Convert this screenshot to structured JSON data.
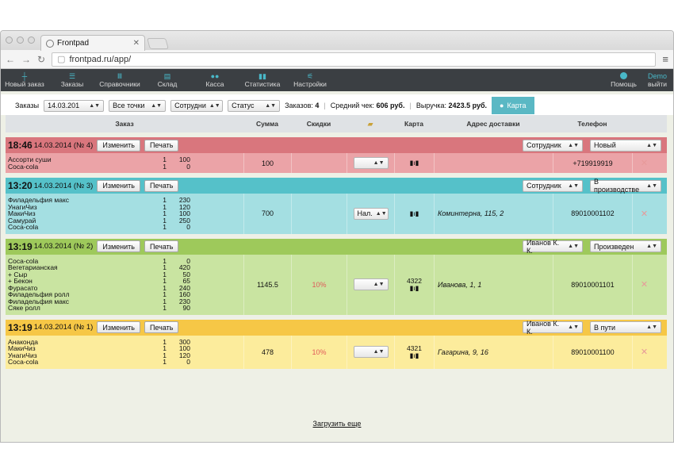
{
  "browser": {
    "tab_title": "Frontpad",
    "url": "frontpad.ru/app/"
  },
  "nav": {
    "items": [
      {
        "label": "Новый заказ",
        "icon": "plus-icon"
      },
      {
        "label": "Заказы",
        "icon": "list-icon"
      },
      {
        "label": "Справочники",
        "icon": "book-icon"
      },
      {
        "label": "Склад",
        "icon": "box-icon"
      },
      {
        "label": "Касса",
        "icon": "cash-icon"
      },
      {
        "label": "Статистика",
        "icon": "chart-icon"
      },
      {
        "label": "Настройки",
        "icon": "settings-icon"
      }
    ],
    "help": "Помощь",
    "user": "Demo",
    "logout": "выйти"
  },
  "filters": {
    "orders_label": "Заказы",
    "date": "14.03.201",
    "points": "Все точки",
    "staff": "Сотрудни",
    "status": "Статус",
    "count_label": "Заказов:",
    "count": "4",
    "avg_label": "Средний чек:",
    "avg": "606 руб.",
    "revenue_label": "Выручка:",
    "revenue": "2423.5 руб.",
    "map": "Карта"
  },
  "columns": {
    "order": "Заказ",
    "sum": "Сумма",
    "discount": "Скидки",
    "card": "Карта",
    "address": "Адрес доставки",
    "phone": "Телефон"
  },
  "orders": [
    {
      "time": "18:46",
      "date": "14.03.2014 (№ 4)",
      "edit": "Изменить",
      "print": "Печать",
      "staff": "Сотрудник",
      "status": "Новый",
      "items": [
        {
          "name": "Ассорти суши",
          "qty": "1",
          "price": "100"
        },
        {
          "name": "Coca-cola",
          "qty": "1",
          "price": "0"
        }
      ],
      "sum": "100",
      "discount": "",
      "payment": "",
      "card": "",
      "address": "",
      "phone": "+719919919"
    },
    {
      "time": "13:20",
      "date": "14.03.2014 (№ 3)",
      "edit": "Изменить",
      "print": "Печать",
      "staff": "Сотрудник",
      "status": "В производстве",
      "items": [
        {
          "name": "Филадельфия макс",
          "qty": "1",
          "price": "230"
        },
        {
          "name": "УнагиЧиз",
          "qty": "1",
          "price": "120"
        },
        {
          "name": "МакиЧиз",
          "qty": "1",
          "price": "100"
        },
        {
          "name": "Самурай",
          "qty": "1",
          "price": "250"
        },
        {
          "name": "Coca-cola",
          "qty": "1",
          "price": "0"
        }
      ],
      "sum": "700",
      "discount": "",
      "payment": "Нал.",
      "card": "",
      "address": "Коминтерна, 115, 2",
      "phone": "89010001102"
    },
    {
      "time": "13:19",
      "date": "14.03.2014 (№ 2)",
      "edit": "Изменить",
      "print": "Печать",
      "staff": "Иванов К. К.",
      "status": "Произведен",
      "items": [
        {
          "name": "Coca-cola",
          "qty": "1",
          "price": "0"
        },
        {
          "name": "Вегетарианская",
          "qty": "1",
          "price": "420"
        },
        {
          "name": "+ Сыр",
          "qty": "1",
          "price": "50"
        },
        {
          "name": "+ Бекон",
          "qty": "1",
          "price": "65"
        },
        {
          "name": "Фурасато",
          "qty": "1",
          "price": "240"
        },
        {
          "name": "Филадельфия ролл",
          "qty": "1",
          "price": "160"
        },
        {
          "name": "Филадельфия макс",
          "qty": "1",
          "price": "230"
        },
        {
          "name": "Сяке ролл",
          "qty": "1",
          "price": "90"
        }
      ],
      "sum": "1145.5",
      "discount": "10%",
      "payment": "",
      "card": "4322",
      "address": "Иванова, 1, 1",
      "phone": "89010001101"
    },
    {
      "time": "13:19",
      "date": "14.03.2014 (№ 1)",
      "edit": "Изменить",
      "print": "Печать",
      "staff": "Иванов К. К.",
      "status": "В пути",
      "items": [
        {
          "name": "Анаконда",
          "qty": "1",
          "price": "300"
        },
        {
          "name": "МакиЧиз",
          "qty": "1",
          "price": "100"
        },
        {
          "name": "УнагиЧиз",
          "qty": "1",
          "price": "120"
        },
        {
          "name": "Coca-cola",
          "qty": "1",
          "price": "0"
        }
      ],
      "sum": "478",
      "discount": "10%",
      "payment": "",
      "card": "4321",
      "address": "Гагарина, 9, 16",
      "phone": "89010001100"
    }
  ],
  "load_more": "Загрузить еще"
}
